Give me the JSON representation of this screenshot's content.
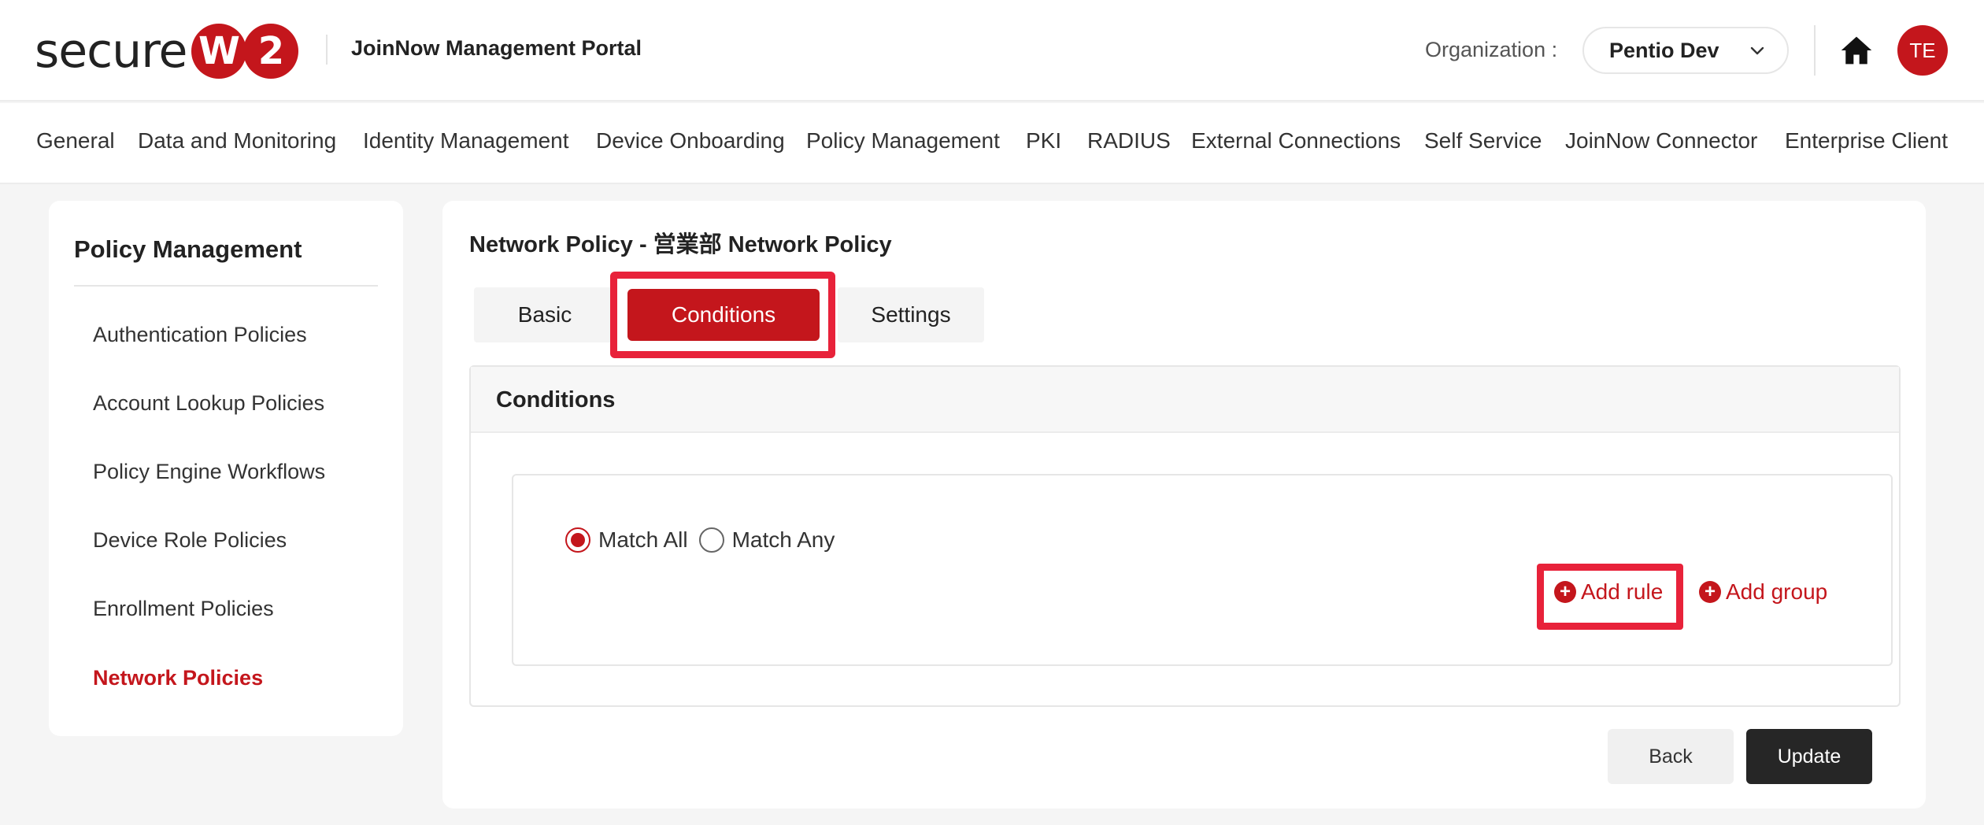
{
  "header": {
    "logo_text": "secure",
    "logo_w": "W",
    "logo_2": "2",
    "portal_title": "JoinNow Management Portal",
    "org_label": "Organization :",
    "org_value": "Pentio Dev",
    "avatar_initials": "TE",
    "brand_color": "#c4161c"
  },
  "nav": {
    "items": [
      {
        "label": "General"
      },
      {
        "label": "Data and Monitoring"
      },
      {
        "label": "Identity Management"
      },
      {
        "label": "Device Onboarding"
      },
      {
        "label": "Policy Management"
      },
      {
        "label": "PKI"
      },
      {
        "label": "RADIUS"
      },
      {
        "label": "External Connections"
      },
      {
        "label": "Self Service"
      },
      {
        "label": "JoinNow Connector"
      },
      {
        "label": "Enterprise Client"
      }
    ]
  },
  "sidebar": {
    "title": "Policy Management",
    "items": [
      {
        "label": "Authentication Policies"
      },
      {
        "label": "Account Lookup Policies"
      },
      {
        "label": "Policy Engine Workflows"
      },
      {
        "label": "Device Role Policies"
      },
      {
        "label": "Enrollment Policies"
      },
      {
        "label": "Network Policies",
        "active": true
      }
    ]
  },
  "main": {
    "page_title": "Network Policy - 営業部 Network Policy",
    "tabs": [
      {
        "label": "Basic"
      },
      {
        "label": "Conditions",
        "active": true
      },
      {
        "label": "Settings"
      }
    ],
    "conditions": {
      "title": "Conditions",
      "match_all_label": "Match All",
      "match_any_label": "Match Any",
      "selected": "Match All",
      "add_rule_label": "Add rule",
      "add_group_label": "Add group"
    },
    "buttons": {
      "back_label": "Back",
      "update_label": "Update"
    }
  }
}
